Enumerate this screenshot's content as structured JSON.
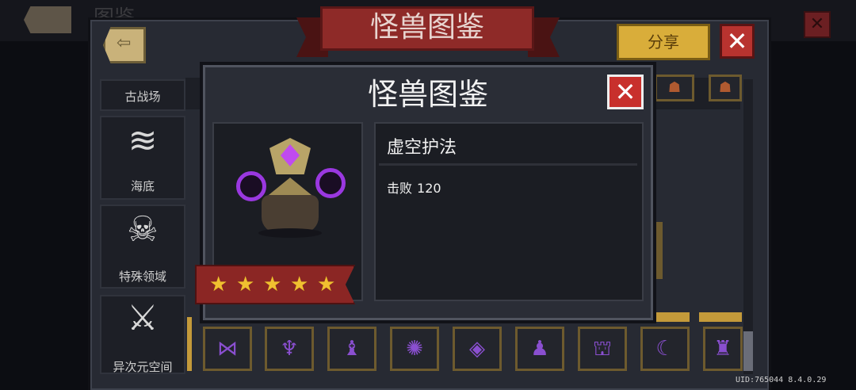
{
  "background": {
    "title": "图鉴",
    "back_icon": "back-arrow-icon",
    "close_icon": "close-icon"
  },
  "panel": {
    "title": "怪兽图鉴",
    "share_label": "分享",
    "close_icon": "close-icon",
    "back_icon": "back-arrow-icon"
  },
  "sidebar": {
    "items": [
      {
        "label": "古战场",
        "icon": "ancient-battlefield-icon"
      },
      {
        "label": "海底",
        "icon": "wave-icon"
      },
      {
        "label": "特殊领域",
        "icon": "demon-face-icon"
      },
      {
        "label": "异次元空间",
        "icon": "crossed-swords-knight-icon"
      }
    ]
  },
  "grid": {
    "bottom_row_slots": 9
  },
  "modal": {
    "title": "怪兽图鉴",
    "close_icon": "close-icon",
    "monster": {
      "name": "虚空护法",
      "kills_label": "击败",
      "kills_value": "120",
      "stars": 5,
      "sprite": "void-guardian-sprite"
    }
  },
  "uid": "UID:765044 8.4.0.29",
  "colors": {
    "accent_gold": "#d9ad3a",
    "banner_red": "#8e2a28",
    "close_red": "#c8302c",
    "void_purple": "#9a38e0",
    "star_yellow": "#f0c030"
  }
}
